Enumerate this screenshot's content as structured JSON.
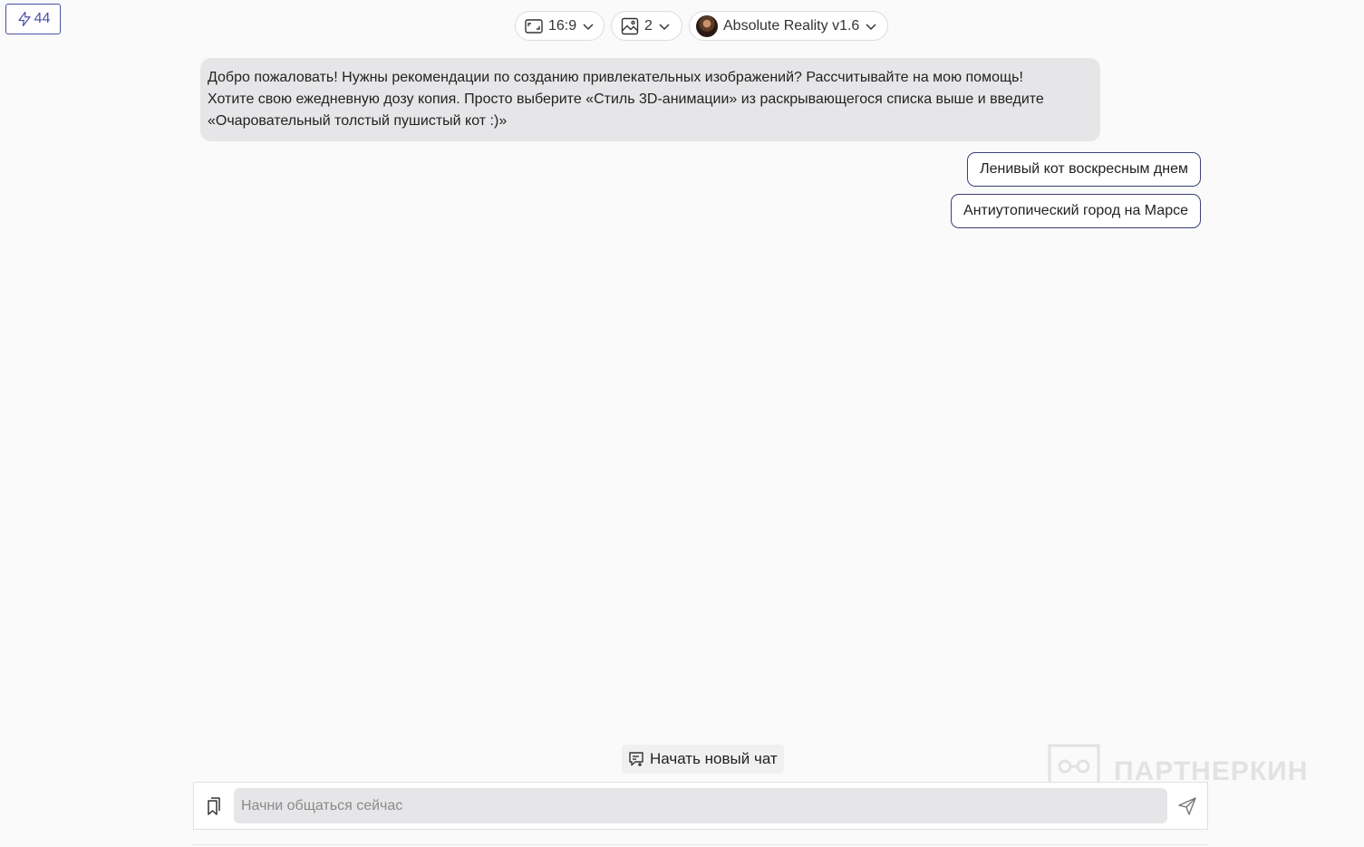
{
  "credits": {
    "count": "44",
    "icon": "lightning-icon"
  },
  "toolbar": {
    "aspect_ratio": {
      "value": "16:9",
      "icon": "aspect-ratio-icon"
    },
    "image_count": {
      "value": "2",
      "icon": "image-icon"
    },
    "model": {
      "name": "Absolute Reality v1.6",
      "icon": "model-avatar"
    }
  },
  "chat": {
    "welcome_lines": [
      "Добро пожаловать! Нужны рекомендации по созданию привлекательных изображений? Рассчитывайте на мою помощь!",
      "Хотите свою ежедневную дозу копия. Просто выберите «Стиль 3D-анимации» из раскрывающегося списка выше и введите",
      "«Очаровательный толстый пушистый кот :)»"
    ],
    "suggestions": [
      "Ленивый кот воскресным днем",
      "Антиутопический город на Марсе"
    ]
  },
  "new_chat": {
    "label": "Начать новый чат",
    "icon": "new-chat-icon"
  },
  "watermark": {
    "text": "ПАРТНЕРКИН"
  },
  "composer": {
    "placeholder": "Начни общаться сейчас",
    "value": "",
    "attach_icon": "bookmark-icon",
    "send_icon": "send-icon"
  },
  "colors": {
    "accent": "#4a4fa8",
    "background": "#fafafa",
    "bubble": "#e6e6e8"
  }
}
